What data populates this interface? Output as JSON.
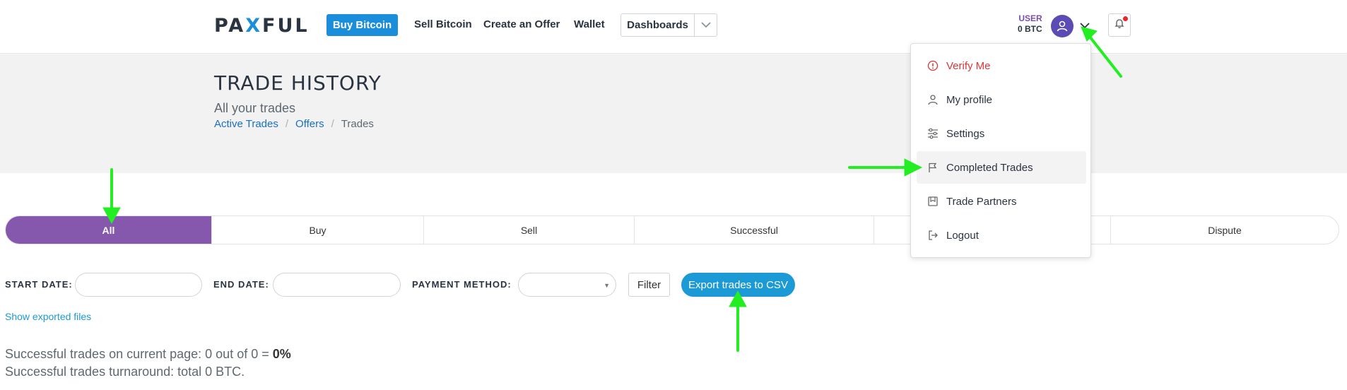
{
  "header": {
    "logo": {
      "pre": "PA",
      "x": "X",
      "post": "FUL"
    },
    "buy_bitcoin": "Buy Bitcoin",
    "nav": [
      "Sell Bitcoin",
      "Create an Offer",
      "Wallet"
    ],
    "dashboards": "Dashboards",
    "user_label": "USER",
    "balance": "0 BTC"
  },
  "page": {
    "title": "TRADE HISTORY",
    "subtitle": "All your trades",
    "breadcrumbs": [
      "Active Trades",
      "Offers",
      "Trades"
    ]
  },
  "tabs": [
    "All",
    "Buy",
    "Sell",
    "Successful",
    "",
    "Dispute"
  ],
  "filters": {
    "start_date_label": "START DATE:",
    "end_date_label": "END DATE:",
    "payment_method_label": "PAYMENT METHOD:",
    "filter_button": "Filter",
    "export_button": "Export trades to CSV",
    "show_exported": "Show exported files"
  },
  "stats": {
    "line1_prefix": "Successful trades on current page: 0 out of 0 = ",
    "line1_value": "0%",
    "line2": "Successful trades turnaround: total 0 BTC."
  },
  "user_menu": {
    "items": [
      "Verify Me",
      "My profile",
      "Settings",
      "Completed Trades",
      "Trade Partners",
      "Logout"
    ]
  },
  "colors": {
    "primary_blue": "#1a8ddb",
    "active_tab": "#8557ad",
    "export_blue": "#1b9ad6",
    "verify_red": "#d63838",
    "annotation_green": "#22ee22"
  }
}
